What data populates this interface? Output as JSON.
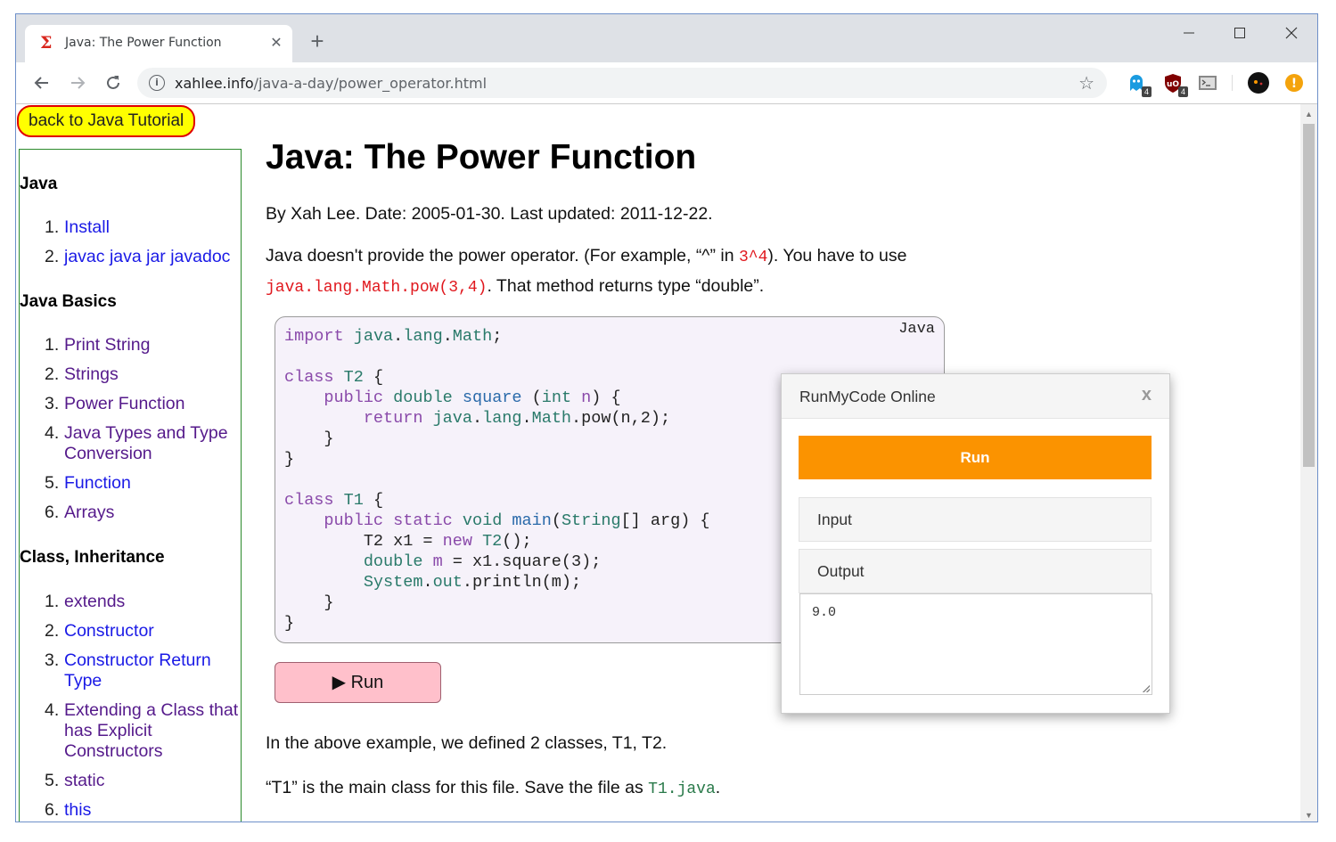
{
  "browser": {
    "tab_title": "Java: The Power Function",
    "tab_close": "✕",
    "new_tab": "+",
    "url_host": "xahlee.info",
    "url_path": "/java-a-day/power_operator.html",
    "extensions": [
      {
        "icon": "ghost-extension-icon",
        "badge": "4"
      },
      {
        "icon": "ublock-extension-icon",
        "badge": "4"
      },
      {
        "icon": "terminal-extension-icon"
      },
      {
        "icon": "profile-avatar-icon"
      },
      {
        "icon": "update-alert-icon",
        "glyph": "!"
      }
    ]
  },
  "page": {
    "back_link": "back to Java Tutorial",
    "sidebar": {
      "sections": [
        {
          "heading": "Java",
          "items": [
            {
              "num": "1.",
              "label": "Install"
            },
            {
              "num": "2.",
              "label": "javac java jar javadoc"
            }
          ]
        },
        {
          "heading": "Java Basics",
          "items": [
            {
              "num": "1.",
              "label": "Print String"
            },
            {
              "num": "2.",
              "label": "Strings"
            },
            {
              "num": "3.",
              "label": "Power Function"
            },
            {
              "num": "4.",
              "label": "Java Types and Type Conversion"
            },
            {
              "num": "5.",
              "label": "Function"
            },
            {
              "num": "6.",
              "label": "Arrays"
            }
          ]
        },
        {
          "heading": "Class, Inheritance",
          "items": [
            {
              "num": "1.",
              "label": "extends"
            },
            {
              "num": "2.",
              "label": "Constructor"
            },
            {
              "num": "3.",
              "label": "Constructor Return Type"
            },
            {
              "num": "4.",
              "label": "Extending a Class that has Explicit Constructors"
            },
            {
              "num": "5.",
              "label": "static"
            },
            {
              "num": "6.",
              "label": "this"
            }
          ]
        }
      ]
    },
    "title": "Java: The Power Function",
    "byline": "By Xah Lee. Date: 2005-01-30. Last updated: 2011-12-22.",
    "para1": {
      "a": "Java doesn't provide the power operator. (For example, “^” in ",
      "code1": "3^4",
      "b": "). You have to use",
      "code2": "java.lang.Math.pow(3,4)",
      "c": ". That method returns type “double”."
    },
    "code_lang": "Java",
    "run_button": "▶ Run",
    "para2": "In the above example, we defined 2 classes, T1, T2.",
    "para3": {
      "a": "“T1” is the main class for this file. Save the file as ",
      "code": "T1.java",
      "b": "."
    }
  },
  "popup": {
    "title": "RunMyCode Online",
    "close": "x",
    "run": "Run",
    "input_label": "Input",
    "output_label": "Output",
    "output_value": "9.0"
  },
  "colors": {
    "accent_orange": "#fb9300",
    "back_link_bg": "#ffff00",
    "back_link_border": "#e00000",
    "run_button_bg": "#ffc0cb",
    "link_blue": "#1a1ae6",
    "link_visited": "#551a8b"
  }
}
